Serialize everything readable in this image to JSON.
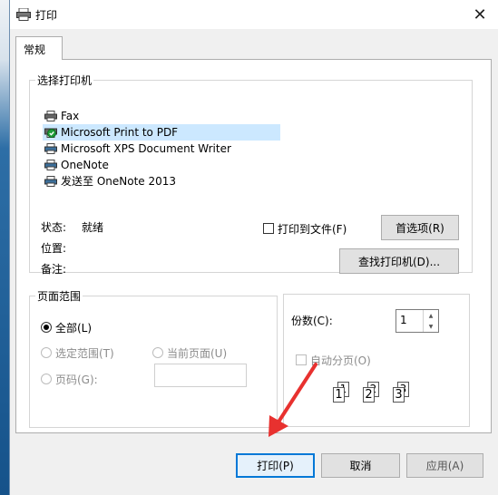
{
  "dialog": {
    "title": "打印",
    "close_glyph": "✕",
    "tab_general": "常规",
    "printer_group_label": "选择打印机",
    "printers": [
      {
        "name": "Fax",
        "icon": "fax-icon",
        "selected": false
      },
      {
        "name": "Microsoft Print to PDF",
        "icon": "default-printer-icon",
        "selected": true
      },
      {
        "name": "Microsoft XPS Document Writer",
        "icon": "printer-icon",
        "selected": false
      },
      {
        "name": "OneNote",
        "icon": "printer-icon",
        "selected": false
      },
      {
        "name": "发送至 OneNote 2013",
        "icon": "printer-icon",
        "selected": false
      }
    ],
    "status_label": "状态:",
    "status_value": "就绪",
    "location_label": "位置:",
    "comment_label": "备注:",
    "print_to_file_label": "打印到文件(F)",
    "preferences_button": "首选项(R)",
    "find_printer_button": "查找打印机(D)...",
    "page_range_group_label": "页面范围",
    "range_all": "全部(L)",
    "range_selection": "选定范围(T)",
    "range_current_page": "当前页面(U)",
    "range_pages": "页码(G):",
    "pages_value": "",
    "copies_label": "份数(C):",
    "copies_value": "1",
    "collate_label": "自动分页(O)",
    "collate_pages": [
      "1",
      "1",
      "2",
      "2",
      "3",
      "3"
    ],
    "print_button": "打印(P)",
    "cancel_button": "取消",
    "apply_button": "应用(A)",
    "accent_color": "#0078d7",
    "arrow_color": "#e8312f"
  }
}
